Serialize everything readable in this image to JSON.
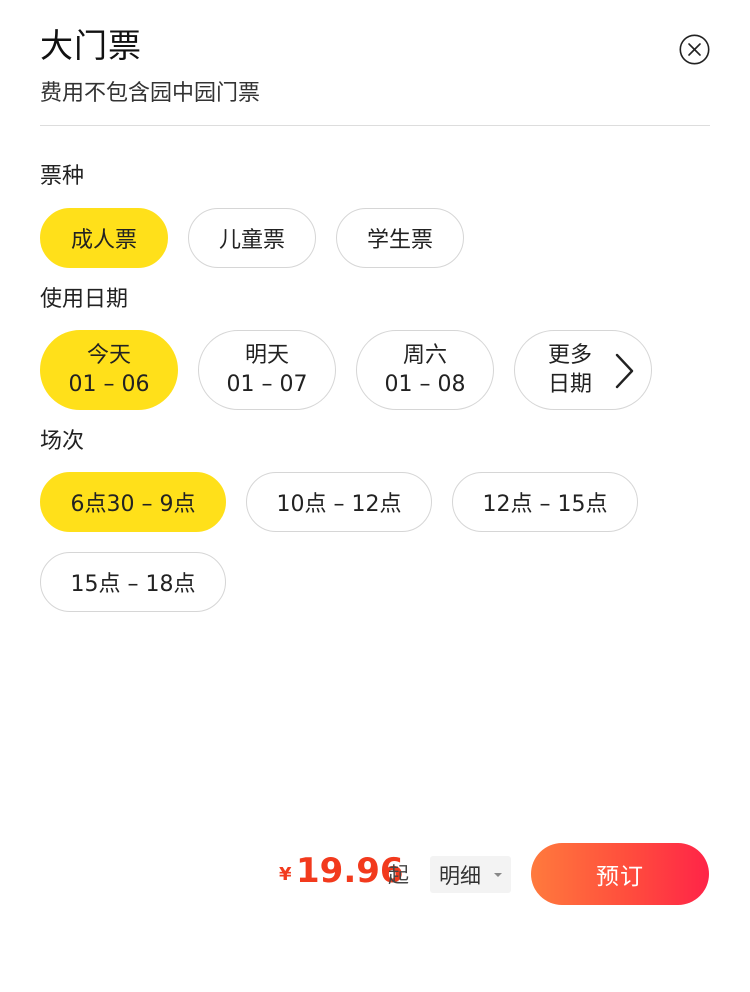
{
  "header": {
    "title": "大门票",
    "subtitle": "费用不包含园中园门票",
    "close_icon": "circle-x-icon"
  },
  "ticket_type": {
    "label": "票种",
    "options": [
      "成人票",
      "儿童票",
      "学生票"
    ],
    "selected": "成人票"
  },
  "use_date": {
    "label": "使用日期",
    "options": [
      {
        "day": "今天",
        "date": "01 – 06"
      },
      {
        "day": "明天",
        "date": "01 – 07"
      },
      {
        "day": "周六",
        "date": "01 – 08"
      }
    ],
    "selected": "今天",
    "more": {
      "line1": "更多",
      "line2": "日期",
      "icon": "chevron-right-icon"
    }
  },
  "session": {
    "label": "场次",
    "options": [
      "6点30 – 9点",
      "10点 – 12点",
      "12点 – 15点",
      "15点 – 18点"
    ],
    "selected": "6点30 – 9点"
  },
  "footer": {
    "currency": "¥",
    "price": "19.96",
    "price_suffix": "起",
    "detail_label": "明细",
    "book_label": "预订"
  },
  "colors": {
    "selected_chip": "#ffe01a",
    "price": "#f23a1d",
    "book_gradient_start": "#ff7a3d",
    "book_gradient_end": "#ff2448"
  }
}
